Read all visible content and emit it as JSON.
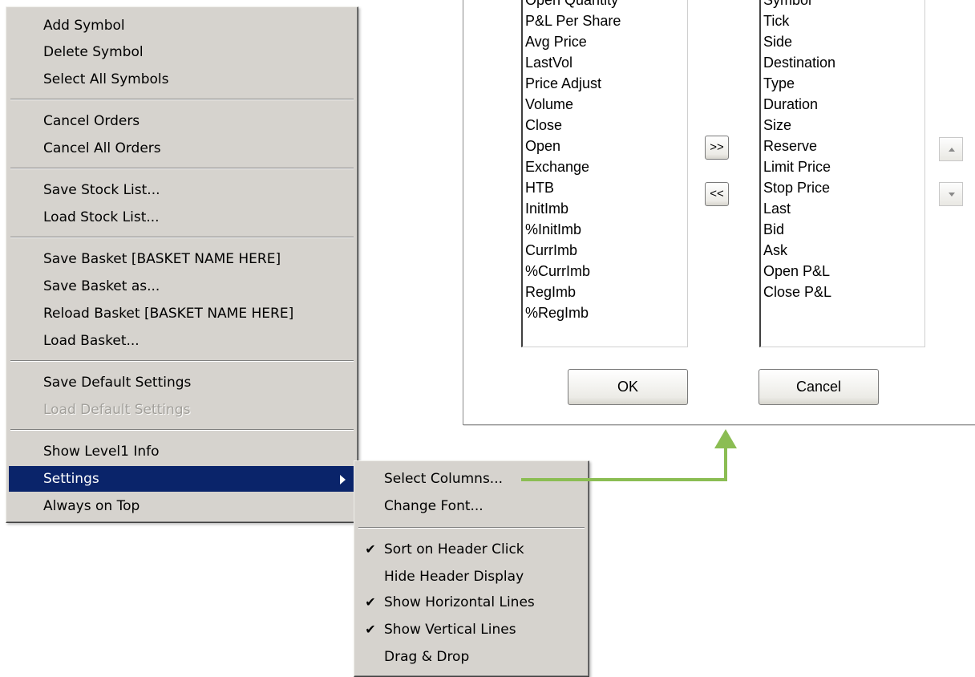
{
  "main_menu": {
    "groups": [
      [
        "Add Symbol",
        "Delete Symbol",
        "Select All Symbols"
      ],
      [
        "Cancel Orders",
        "Cancel All Orders"
      ],
      [
        "Save Stock List...",
        "Load Stock List..."
      ],
      [
        "Save Basket [BASKET NAME HERE]",
        "Save Basket as...",
        "Reload Basket [BASKET NAME HERE]",
        "Load Basket..."
      ],
      [
        "Save Default Settings",
        "Load Default Settings"
      ],
      [
        "Show Level1 Info",
        "Settings",
        "Always on Top"
      ]
    ],
    "disabled_item": "Load Default Settings",
    "highlighted_item": "Settings"
  },
  "settings_submenu": {
    "items": [
      "Select Columns...",
      "Change Font...",
      "Sort on Header Click",
      "Hide Header Display",
      "Show Horizontal Lines",
      "Show Vertical Lines",
      "Drag & Drop"
    ],
    "checked": [
      false,
      false,
      true,
      false,
      true,
      true,
      false
    ]
  },
  "dialog": {
    "available_columns": [
      "Open Quantity",
      "P&L Per Share",
      "Avg Price",
      "LastVol",
      "Price Adjust",
      "Volume",
      "Close",
      "Open",
      "Exchange",
      "HTB",
      "InitImb",
      "%InitImb",
      "CurrImb",
      "%CurrImb",
      "RegImb",
      "%RegImb"
    ],
    "selected_columns": [
      "Symbol",
      "Tick",
      "Side",
      "Destination",
      "Type",
      "Duration",
      "Size",
      "Reserve",
      "Limit Price",
      "Stop Price",
      "Last",
      "Bid",
      "Ask",
      "Open P&L",
      "Close P&L"
    ],
    "add_label": ">>",
    "remove_label": "<<",
    "ok_label": "OK",
    "cancel_label": "Cancel"
  },
  "colors": {
    "menu_background": "#d6d3ce",
    "highlight": "#0a246a",
    "callout": "#8bbd53"
  }
}
